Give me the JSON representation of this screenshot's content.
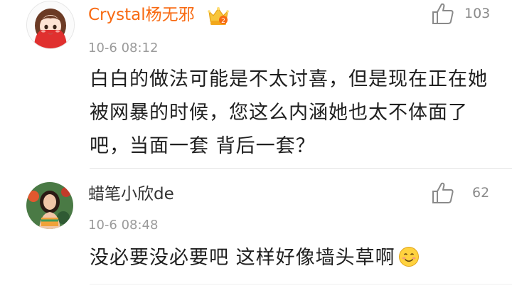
{
  "comments": [
    {
      "username": "Crystal杨无邪",
      "badge_icon": "vip-crown-badge-icon",
      "avatar_icon": "girl-cartoon-avatar",
      "time": "10-6 08:12",
      "like_count": "103",
      "text": "白白的做法可能是不太讨喜，但是现在正在她被网暴的时候，您这么内涵她也太不体面了吧，当面一套 背后一套？"
    },
    {
      "username": "蜡笔小欣de",
      "avatar_icon": "photo-avatar",
      "time": "10-6 08:48",
      "like_count": "62",
      "text": "没必要没必要吧 这样好像墙头草啊",
      "emoji": "smile-emoji-icon"
    }
  ],
  "colors": {
    "vip_username": "#f86a12",
    "username": "#333333",
    "meta": "#9b9b9b"
  }
}
